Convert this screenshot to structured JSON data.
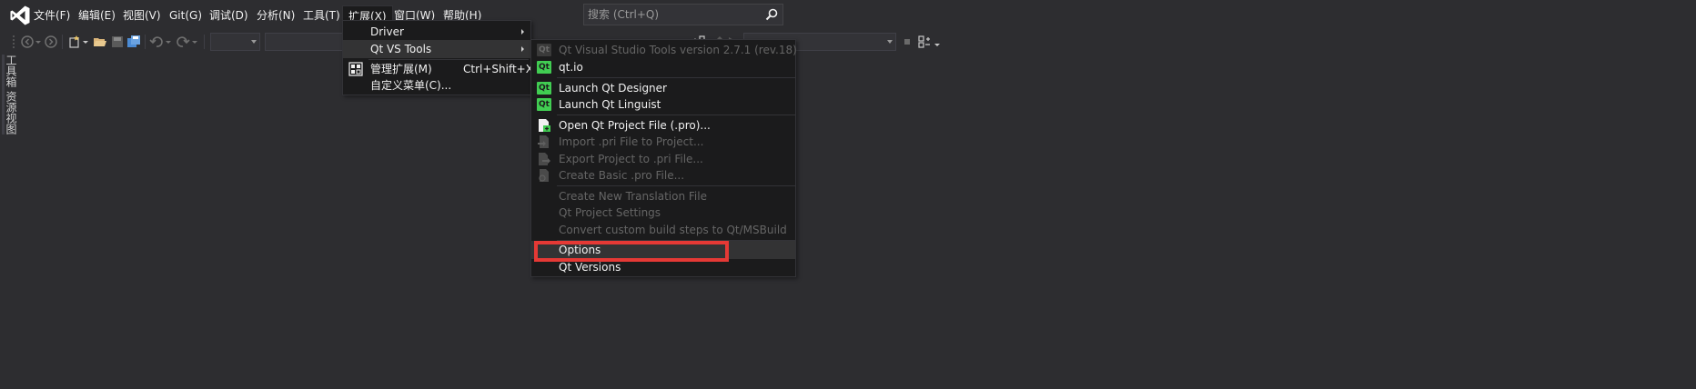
{
  "menubar": {
    "items": [
      "文件(F)",
      "编辑(E)",
      "视图(V)",
      "Git(G)",
      "调试(D)",
      "分析(N)",
      "工具(T)",
      "扩展(X)",
      "窗口(W)",
      "帮助(H)"
    ],
    "active_index": 7,
    "search_placeholder": "搜索 (Ctrl+Q)"
  },
  "side_tabs": [
    "工具箱",
    "资源视图"
  ],
  "extensions_menu": {
    "items": [
      {
        "label": "Driver",
        "submenu": true
      },
      {
        "label": "Qt VS Tools",
        "submenu": true,
        "hover": true
      },
      {
        "label": "管理扩展(M)",
        "shortcut": "Ctrl+Shift+X",
        "icon": "manage-extensions-icon"
      },
      {
        "label": "自定义菜单(C)..."
      }
    ]
  },
  "qt_menu": {
    "items": [
      {
        "label": "Qt Visual Studio Tools version 2.7.1 (rev.18)",
        "enabled": false,
        "icon": "qt-icon"
      },
      {
        "label": "qt.io",
        "enabled": true,
        "icon": "qt-icon"
      },
      {
        "label": "Launch Qt Designer",
        "enabled": true,
        "icon": "qt-designer-icon"
      },
      {
        "label": "Launch Qt Linguist",
        "enabled": true,
        "icon": "qt-linguist-icon"
      },
      {
        "label": "Open Qt Project File (.pro)...",
        "enabled": true,
        "icon": "open-project-icon"
      },
      {
        "label": "Import .pri File to Project...",
        "enabled": false,
        "icon": "import-pri-icon"
      },
      {
        "label": "Export Project to .pri File...",
        "enabled": false,
        "icon": "export-pri-icon"
      },
      {
        "label": "Create Basic .pro File...",
        "enabled": false,
        "icon": "create-pro-icon"
      },
      {
        "label": "Create New Translation File",
        "enabled": false
      },
      {
        "label": "Qt Project Settings",
        "enabled": false
      },
      {
        "label": "Convert custom build steps to Qt/MSBuild",
        "enabled": false
      },
      {
        "label": "Options",
        "enabled": true,
        "hover": true
      },
      {
        "label": "Qt Versions",
        "enabled": true
      }
    ],
    "highlighted_item": "Options",
    "highlight_color": "#e53935"
  },
  "colors": {
    "background": "#2d2d30",
    "menu_background": "#1b1b1c",
    "qt_green": "#41cd52",
    "vs_purple": "#ffffff"
  }
}
